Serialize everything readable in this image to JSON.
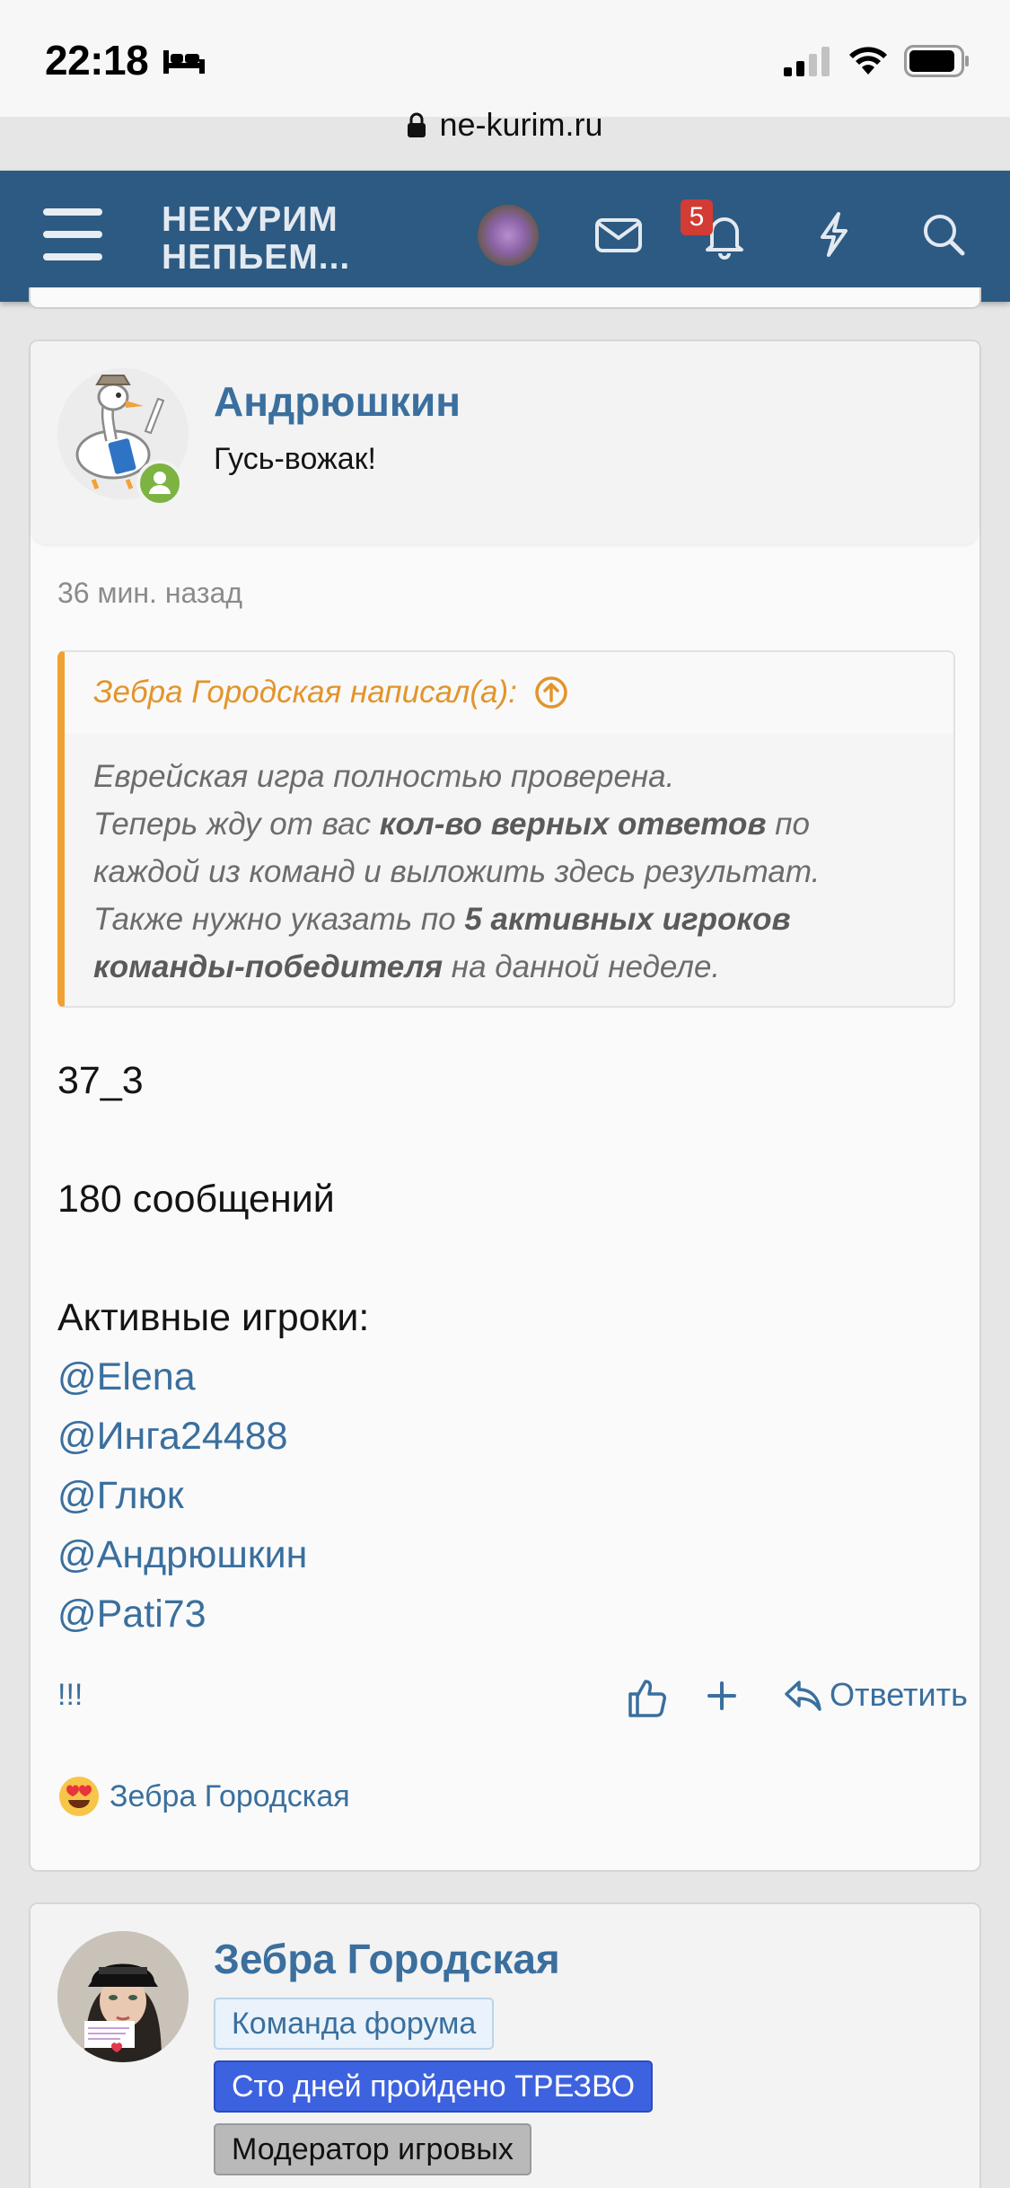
{
  "status_bar": {
    "time": "22:18"
  },
  "browser": {
    "url": "ne-kurim.ru"
  },
  "nav": {
    "logo_line1": "НЕКУРИМ",
    "logo_line2": "НЕПЬЕМ...",
    "notification_count": "5"
  },
  "post": {
    "username": "Андрюшкин",
    "user_title": "Гусь-вожак!",
    "time": "36 мин. назад",
    "quote": {
      "author": "Зебра Городская написал(а):",
      "line1": "Еврейская игра полностью проверена.",
      "line2_a": "Теперь жду от вас ",
      "line2_b": "кол-во верных ответов",
      "line2_c": " по",
      "line3": "каждой из команд и выложить здесь результат.",
      "line4_a": "Также нужно указать по ",
      "line4_b": "5 активных игроков",
      "line5_b": "команды-победителя",
      "line5_c": " на данной неделе."
    },
    "content": {
      "line1": "37_3",
      "line2": "180 сообщений",
      "line3": "Активные игроки:",
      "mentions": [
        "@Elena",
        "@Инга24488",
        "@Глюк",
        "@Андрюшкин",
        "@Pati73"
      ]
    },
    "actions": {
      "report": "!!!",
      "reply": "Ответить"
    },
    "reaction_user": "Зебра Городская"
  },
  "next_post": {
    "username": "Зебра Городская",
    "tags": [
      "Команда форума",
      "Сто дней пройдено ТРЕЗВО",
      "Модератор игровых"
    ]
  },
  "colors": {
    "nav_bg": "#2c5a82",
    "link": "#3a6f9e",
    "quote_accent": "#f0a132",
    "online": "#7cb342",
    "badge": "#d33b35"
  }
}
